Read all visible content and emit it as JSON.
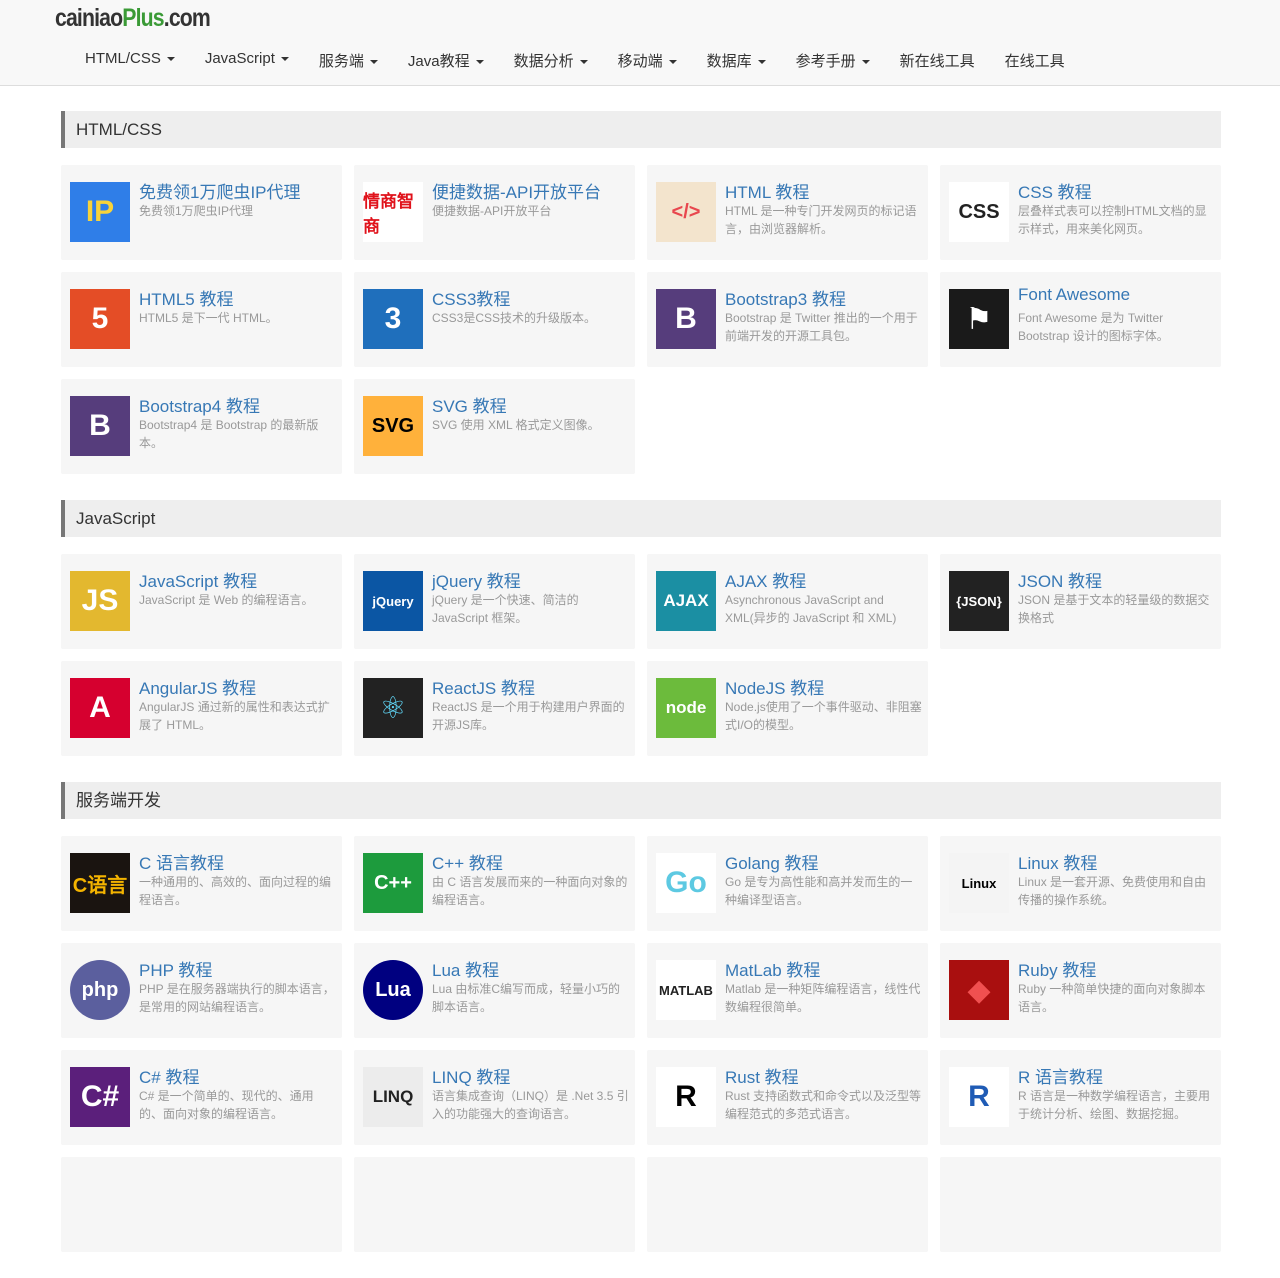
{
  "logo": {
    "part1": "cainiao",
    "part2": "Plus",
    "part3": ".com"
  },
  "nav": [
    {
      "label": "HTML/CSS",
      "dropdown": true
    },
    {
      "label": "JavaScript",
      "dropdown": true
    },
    {
      "label": "服务端",
      "dropdown": true
    },
    {
      "label": "Java教程",
      "dropdown": true
    },
    {
      "label": "数据分析",
      "dropdown": true
    },
    {
      "label": "移动端",
      "dropdown": true
    },
    {
      "label": "数据库",
      "dropdown": true
    },
    {
      "label": "参考手册",
      "dropdown": true
    },
    {
      "label": "新在线工具",
      "dropdown": false
    },
    {
      "label": "在线工具",
      "dropdown": false
    }
  ],
  "sections": [
    {
      "title": "HTML/CSS",
      "items": [
        {
          "title": "免费领1万爬虫IP代理",
          "desc": "免费领1万爬虫IP代理",
          "icon": "proxy-ad-icon",
          "icon_text": "IP",
          "bg": "#2f7ee8",
          "fg": "#f7d33a"
        },
        {
          "title": "便捷数据-API开放平台",
          "desc": "便捷数据-API开放平台",
          "icon": "api-platform-icon",
          "icon_text": "情商智商",
          "bg": "#ffffff",
          "fg": "#e0121b"
        },
        {
          "title": "HTML 教程",
          "desc": "HTML 是一种专门开发网页的标记语言，由浏览器解析。",
          "icon": "html-icon",
          "icon_text": "</>",
          "bg": "#f3e4cd",
          "fg": "#e8474e"
        },
        {
          "title": "CSS 教程",
          "desc": "层叠样式表可以控制HTML文档的显示样式，用来美化网页。",
          "icon": "css-icon",
          "icon_text": "CSS",
          "bg": "#ffffff",
          "fg": "#222"
        },
        {
          "title": "HTML5 教程",
          "desc": "HTML5 是下一代 HTML。",
          "icon": "html5-icon",
          "icon_text": "5",
          "bg": "#e44d26",
          "fg": "#fff"
        },
        {
          "title": "CSS3教程",
          "desc": "CSS3是CSS技术的升级版本。",
          "icon": "css3-icon",
          "icon_text": "3",
          "bg": "#1f6fbc",
          "fg": "#fff"
        },
        {
          "title": "Bootstrap3 教程",
          "desc": "Bootstrap 是 Twitter 推出的一个用于前端开发的开源工具包。",
          "icon": "bootstrap-icon",
          "icon_text": "B",
          "bg": "#563d7c",
          "fg": "#fff"
        },
        {
          "title": "Font Awesome",
          "desc": "Font Awesome 是为 Twitter Bootstrap 设计的图标字体。",
          "icon": "flag-icon",
          "icon_text": "⚑",
          "bg": "#1a1a1a",
          "fg": "#fff"
        },
        {
          "title": "Bootstrap4 教程",
          "desc": "Bootstrap4 是 Bootstrap 的最新版本。",
          "icon": "bootstrap-icon",
          "icon_text": "B",
          "bg": "#563d7c",
          "fg": "#fff"
        },
        {
          "title": "SVG 教程",
          "desc": "SVG 使用 XML 格式定义图像。",
          "icon": "svg-icon",
          "icon_text": "SVG",
          "bg": "#ffb13b",
          "fg": "#000"
        }
      ]
    },
    {
      "title": "JavaScript",
      "items": [
        {
          "title": "JavaScript 教程",
          "desc": "JavaScript 是 Web 的编程语言。",
          "icon": "javascript-icon",
          "icon_text": "JS",
          "bg": "#e3b82f",
          "fg": "#fff"
        },
        {
          "title": "jQuery 教程",
          "desc": "jQuery 是一个快速、简洁的 JavaScript 框架。",
          "icon": "jquery-icon",
          "icon_text": "jQuery",
          "bg": "#0b56a4",
          "fg": "#fff"
        },
        {
          "title": "AJAX 教程",
          "desc": "Asynchronous JavaScript and XML(异步的 JavaScript 和 XML)",
          "icon": "ajax-icon",
          "icon_text": "AJAX",
          "bg": "#1b8fa3",
          "fg": "#fff"
        },
        {
          "title": "JSON 教程",
          "desc": "JSON 是基于文本的轻量级的数据交换格式",
          "icon": "json-icon",
          "icon_text": "{JSON}",
          "bg": "#222",
          "fg": "#fff"
        },
        {
          "title": "AngularJS 教程",
          "desc": "AngularJS 通过新的属性和表达式扩展了 HTML。",
          "icon": "angular-icon",
          "icon_text": "A",
          "bg": "#d6002f",
          "fg": "#fff"
        },
        {
          "title": "ReactJS 教程",
          "desc": "ReactJS 是一个用于构建用户界面的开源JS库。",
          "icon": "react-icon",
          "icon_text": "⚛",
          "bg": "#222",
          "fg": "#61dafb"
        },
        {
          "title": "NodeJS 教程",
          "desc": "Node.js使用了一个事件驱动、非阻塞式I/O的模型。",
          "icon": "nodejs-icon",
          "icon_text": "node",
          "bg": "#6cbb3c",
          "fg": "#fff"
        }
      ]
    },
    {
      "title": "服务端开发",
      "items": [
        {
          "title": "C 语言教程",
          "desc": "一种通用的、高效的、面向过程的编程语言。",
          "icon": "c-language-icon",
          "icon_text": "C语言",
          "bg": "#1a1410",
          "fg": "#f4b400"
        },
        {
          "title": "C++ 教程",
          "desc": "由 C 语言发展而来的一种面向对象的编程语言。",
          "icon": "cpp-icon",
          "icon_text": "C++",
          "bg": "#1d9b3d",
          "fg": "#fff"
        },
        {
          "title": "Golang 教程",
          "desc": "Go 是专为高性能和高并发而生的一种编译型语言。",
          "icon": "gopher-icon",
          "icon_text": "Go",
          "bg": "#ffffff",
          "fg": "#5dc9e2"
        },
        {
          "title": "Linux 教程",
          "desc": "Linux 是一套开源、免费使用和自由传播的操作系统。",
          "icon": "linux-penguin-icon",
          "icon_text": "Linux",
          "bg": "#f4f4f4",
          "fg": "#000"
        },
        {
          "title": "PHP 教程",
          "desc": "PHP 是在服务器端执行的脚本语言，是常用的网站编程语言。",
          "icon": "php-icon",
          "icon_text": "php",
          "bg": "#5b5f9e",
          "fg": "#fff"
        },
        {
          "title": "Lua 教程",
          "desc": "Lua 由标准C编写而成，轻量小巧的脚本语言。",
          "icon": "lua-icon",
          "icon_text": "Lua",
          "bg": "#000080",
          "fg": "#fff"
        },
        {
          "title": "MatLab 教程",
          "desc": "Matlab 是一种矩阵编程语言，线性代数编程很简单。",
          "icon": "matlab-icon",
          "icon_text": "MATLAB",
          "bg": "#ffffff",
          "fg": "#222"
        },
        {
          "title": "Ruby 教程",
          "desc": "Ruby 一种简单快捷的面向对象脚本语言。",
          "icon": "ruby-icon",
          "icon_text": "◆",
          "bg": "#a90f0f",
          "fg": "#f05050"
        },
        {
          "title": "C# 教程",
          "desc": "C# 是一个简单的、现代的、通用的、面向对象的编程语言。",
          "icon": "csharp-icon",
          "icon_text": "C#",
          "bg": "#5b1f7b",
          "fg": "#fff"
        },
        {
          "title": "LINQ 教程",
          "desc": "语言集成查询（LINQ）是 .Net 3.5 引入的功能强大的查询语言。",
          "icon": "linq-icon",
          "icon_text": "LINQ",
          "bg": "#ececec",
          "fg": "#222"
        },
        {
          "title": "Rust 教程",
          "desc": "Rust 支持函数式和命令式以及泛型等编程范式的多范式语言。",
          "icon": "rust-icon",
          "icon_text": "R",
          "bg": "#ffffff",
          "fg": "#000"
        },
        {
          "title": "R 语言教程",
          "desc": "R 语言是一种数学编程语言，主要用于统计分析、绘图、数据挖掘。",
          "icon": "r-language-icon",
          "icon_text": "R",
          "bg": "#ffffff",
          "fg": "#1f5bb5"
        }
      ]
    }
  ]
}
